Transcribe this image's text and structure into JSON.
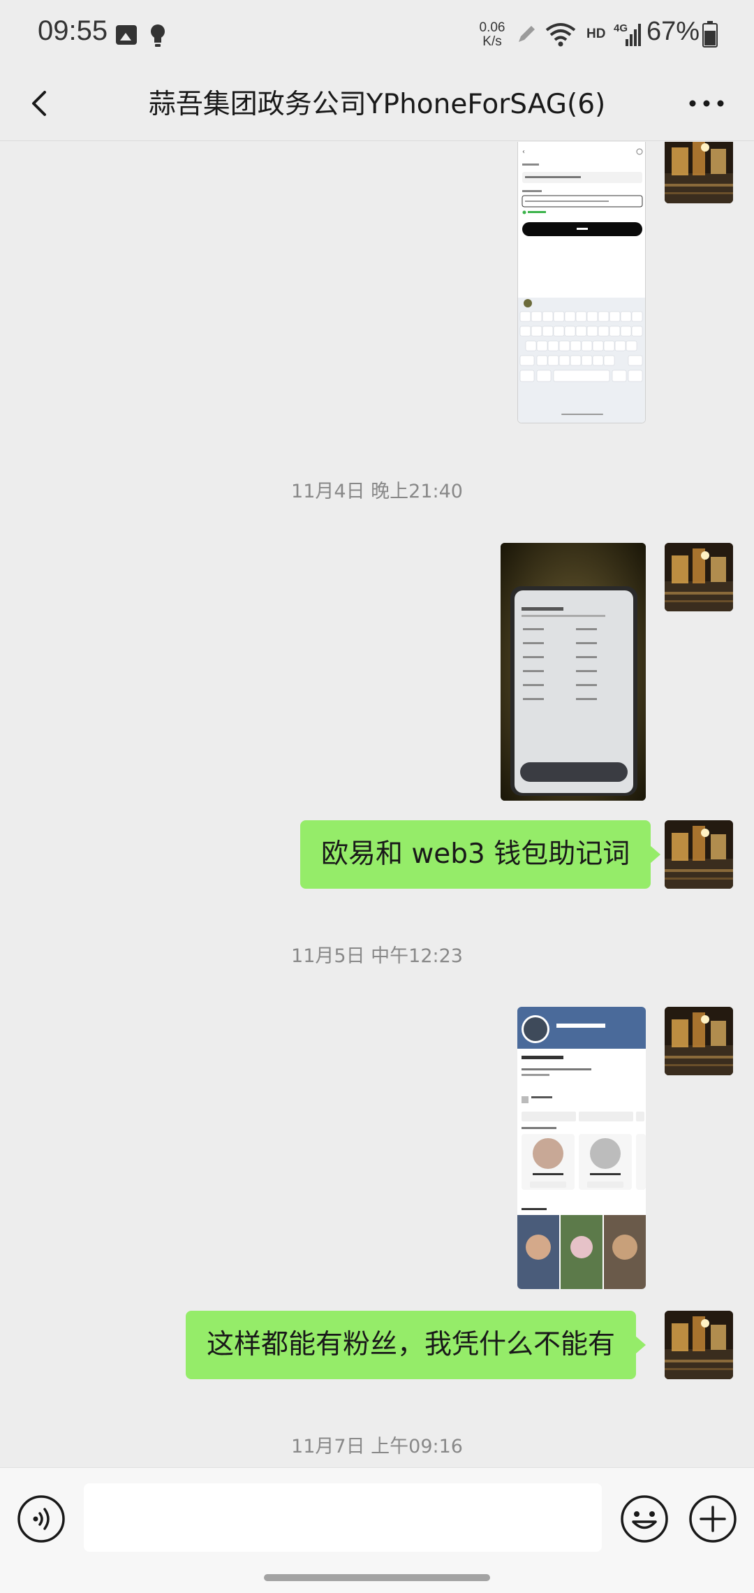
{
  "status_bar": {
    "time": "09:55",
    "network_speed_value": "0.06",
    "network_speed_unit": "K/s",
    "hd_label": "HD",
    "network_type": "4G",
    "battery": "67%",
    "icons": [
      "image-icon",
      "bulb-icon",
      "pen-icon",
      "wifi-icon",
      "signal-icon",
      "battery-icon"
    ]
  },
  "header": {
    "title": "蒜吾集团政务公司YPhoneForSAG(6)",
    "back_icon": "chevron-left-icon",
    "more_icon": "more-horizontal-icon"
  },
  "messages": [
    {
      "type": "image",
      "description": "screenshot"
    },
    {
      "type": "timestamp",
      "text": "11月4日 晚上21:40"
    },
    {
      "type": "image",
      "description": "photo"
    },
    {
      "type": "text",
      "text": "欧易和 web3 钱包助记词"
    },
    {
      "type": "timestamp",
      "text": "11月5日 中午12:23"
    },
    {
      "type": "image",
      "description": "screenshot"
    },
    {
      "type": "text",
      "text": "这样都能有粉丝，我凭什么不能有"
    },
    {
      "type": "timestamp",
      "text": "11月7日 上午09:16"
    }
  ],
  "input_bar": {
    "placeholder": "",
    "voice_icon": "voice-icon",
    "emoji_icon": "emoji-icon",
    "plus_icon": "plus-circle-icon"
  },
  "colors": {
    "background": "#ededed",
    "bubble_green": "#95ec69",
    "input_bar": "#f7f7f7",
    "timestamp_text": "#888888"
  }
}
